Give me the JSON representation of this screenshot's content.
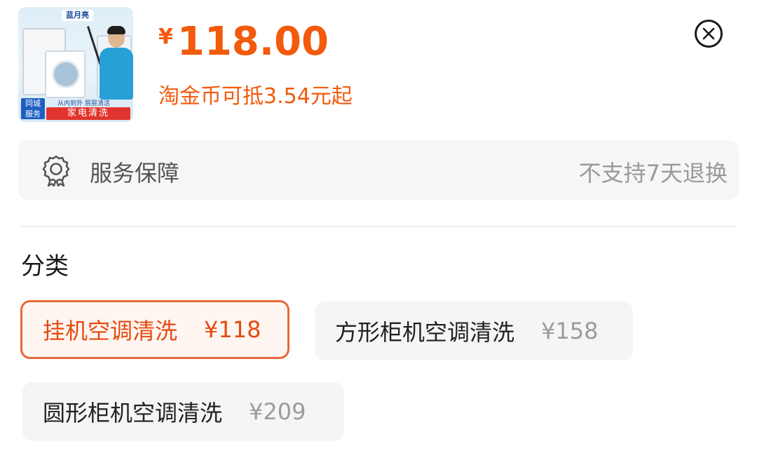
{
  "product": {
    "thumbnail": {
      "brand_text": "蓝月亮",
      "city_badge": "同城\n服务",
      "slogan": "从内到外 层层清洁",
      "service_tag": "家电清洗"
    },
    "currency_symbol": "¥",
    "price": "118.00",
    "coin_text": "淘金币可抵3.54元起"
  },
  "service": {
    "label": "服务保障",
    "value": "不支持7天退换",
    "icon": "badge-icon"
  },
  "section": {
    "title": "分类"
  },
  "options": [
    {
      "name": "挂机空调清洗",
      "price": "¥118",
      "selected": true
    },
    {
      "name": "方形柜机空调清洗",
      "price": "¥158",
      "selected": false
    },
    {
      "name": "圆形柜机空调清洗",
      "price": "¥209",
      "selected": false
    }
  ],
  "colors": {
    "accent": "#f25a0c",
    "selected_border": "#e8683b",
    "chip_bg": "#f5f5f5"
  },
  "icons": {
    "close": "close-circle-icon"
  }
}
